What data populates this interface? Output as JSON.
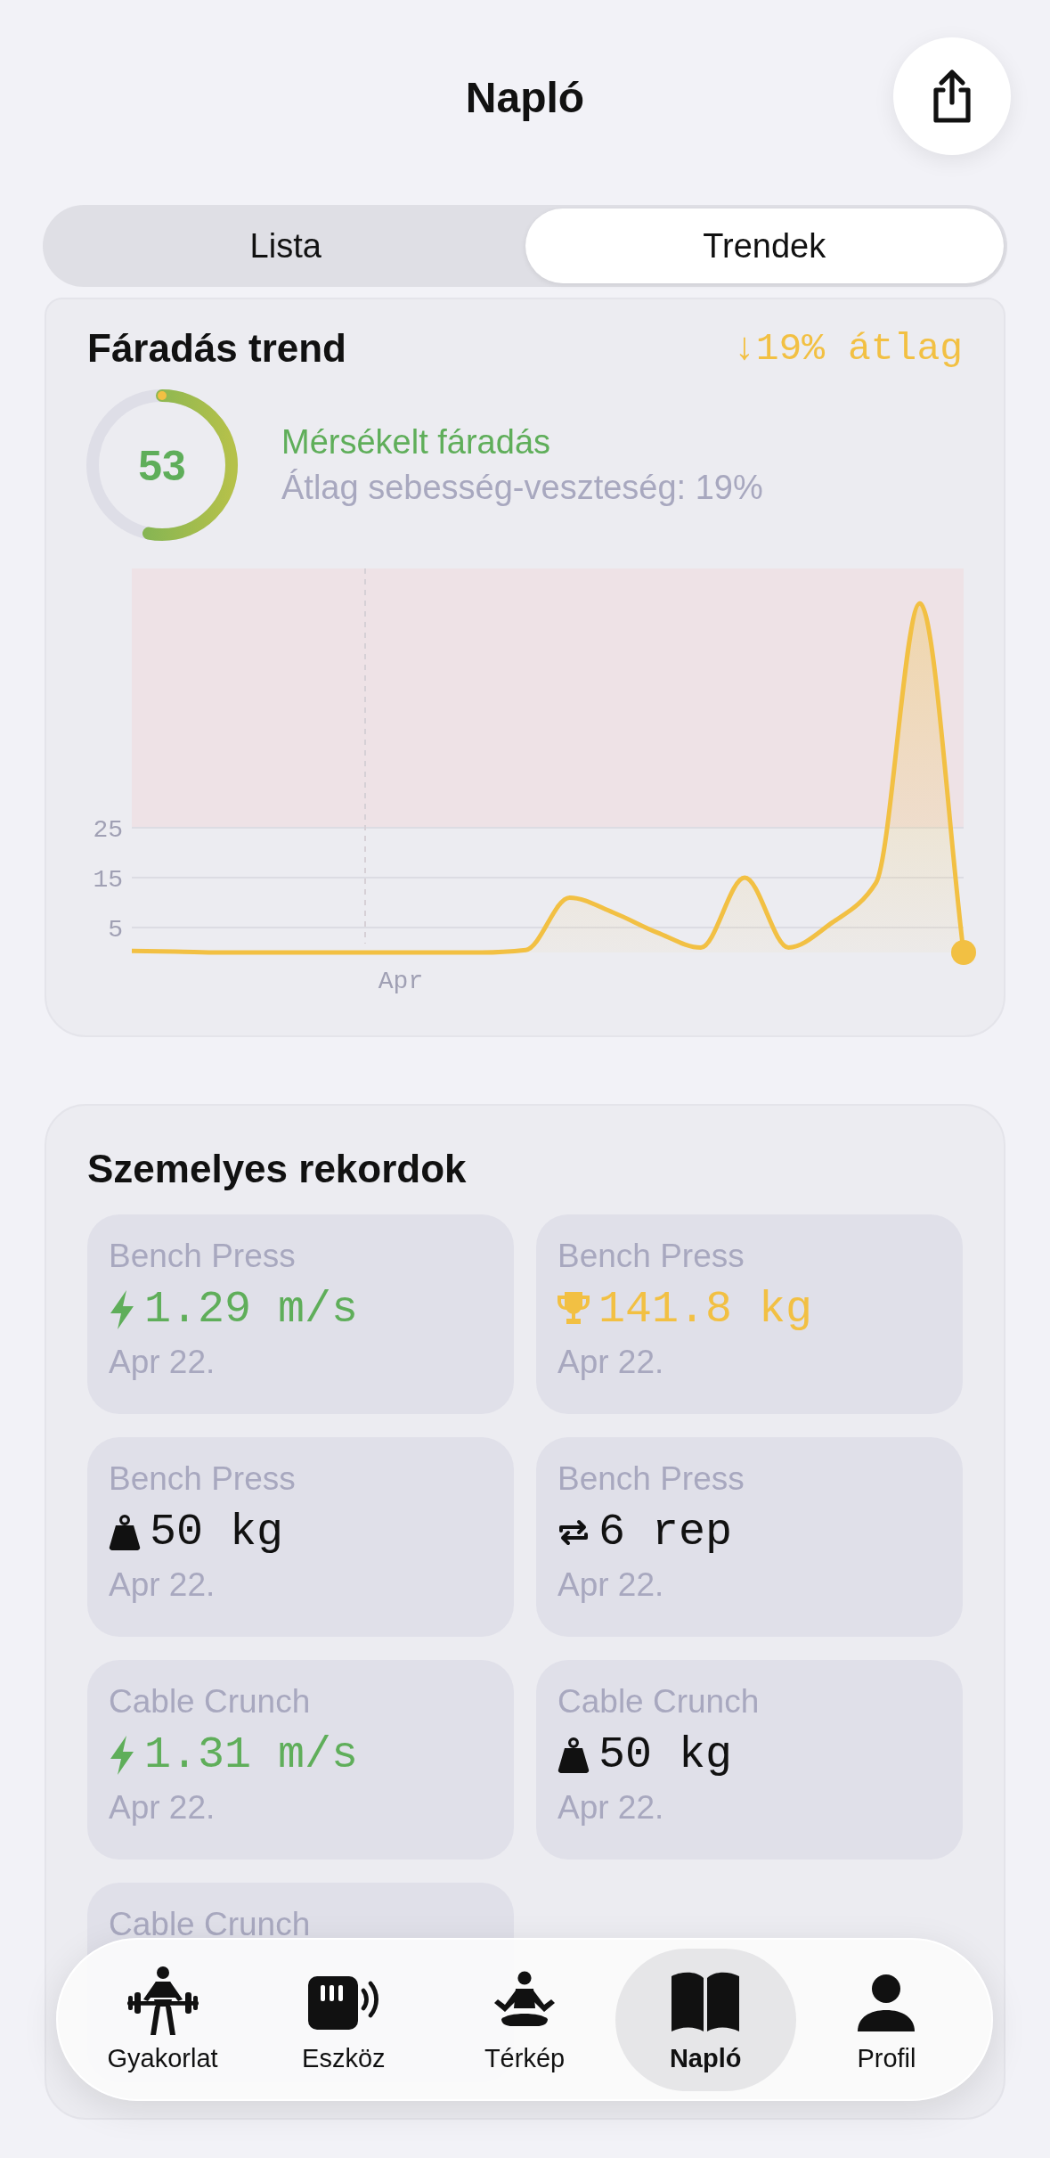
{
  "header": {
    "title": "Napló"
  },
  "segments": [
    {
      "label": "Lista",
      "selected": false
    },
    {
      "label": "Trendek",
      "selected": true
    }
  ],
  "fatigue": {
    "title": "Fáradás trend",
    "trend": "↓19% átlag",
    "score": "53",
    "level": 0.53,
    "status": "Mérsékelt fáradás",
    "detail": "Átlag sebesség-veszteség: 19%",
    "chart_data": {
      "type": "area",
      "series": [
        {
          "color": "#f2c043",
          "values": [
            0.3,
            0.2,
            0,
            0,
            0,
            0,
            0,
            0,
            0,
            0.5,
            11,
            8,
            4,
            1,
            15,
            1,
            6,
            14,
            70,
            0
          ]
        }
      ],
      "ylim": [
        0,
        77
      ],
      "yticks": [
        5,
        15,
        25
      ],
      "grid": true,
      "annotations": [
        "Apr"
      ]
    }
  },
  "records": {
    "title": "Szemelyes rekordok",
    "items": [
      {
        "kind": "speed",
        "exercise": "Bench Press",
        "value": "1.29 m/s",
        "date": "Apr 22."
      },
      {
        "kind": "max",
        "exercise": "Bench Press",
        "value": "141.8 kg",
        "date": "Apr 22."
      },
      {
        "kind": "load",
        "exercise": "Bench Press",
        "value": "50 kg",
        "date": "Apr 22."
      },
      {
        "kind": "reps",
        "exercise": "Bench Press",
        "value": "6 rep",
        "date": "Apr 22."
      },
      {
        "kind": "speed",
        "exercise": "Cable Crunch",
        "value": "1.31 m/s",
        "date": "Apr 22."
      },
      {
        "kind": "load",
        "exercise": "Cable Crunch",
        "value": "50 kg",
        "date": "Apr 22."
      },
      {
        "exercise": "Cable Crunch"
      }
    ]
  },
  "tabbar": [
    {
      "label": "Gyakorlat",
      "selected": false
    },
    {
      "label": "Eszköz",
      "selected": false
    },
    {
      "label": "Térkép",
      "selected": false
    },
    {
      "label": "Napló",
      "selected": true
    },
    {
      "label": "Profil",
      "selected": false
    }
  ]
}
